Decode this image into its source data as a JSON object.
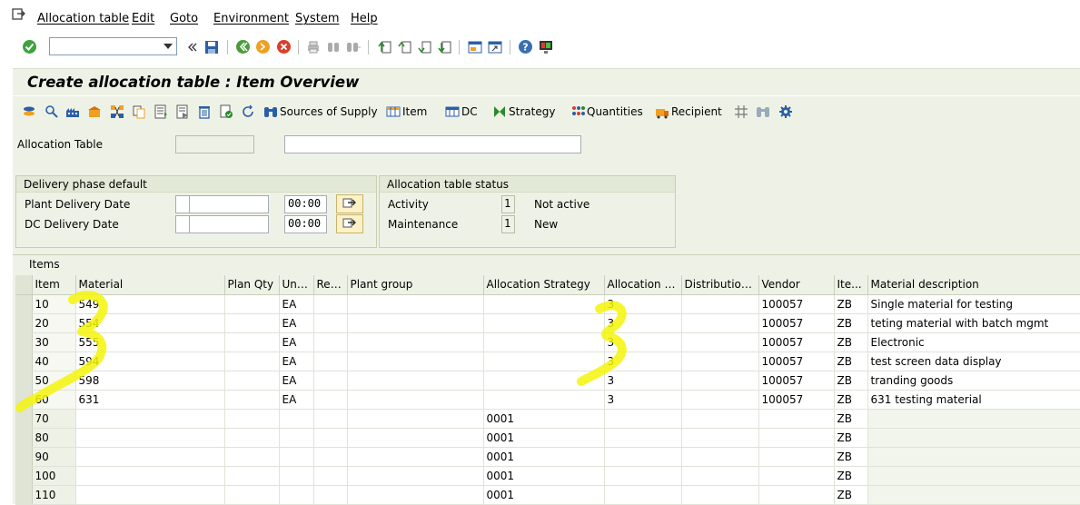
{
  "menu": {
    "items": [
      "Allocation table",
      "Edit",
      "Goto",
      "Environment",
      "System",
      "Help"
    ]
  },
  "command_field": {
    "value": ""
  },
  "title": "Create allocation table : Item Overview",
  "app_toolbar": {
    "sources_of_supply": "Sources of Supply",
    "item": "Item",
    "dc": "DC",
    "strategy": "Strategy",
    "quantities": "Quantities",
    "recipient": "Recipient"
  },
  "header": {
    "allocation_table_label": "Allocation Table",
    "allocation_table_value": "",
    "allocation_table_desc": ""
  },
  "delivery_phase": {
    "title": "Delivery phase default",
    "plant_label": "Plant Delivery Date",
    "plant_time": "00:00",
    "dc_label": "DC Delivery Date",
    "dc_time": "00:00"
  },
  "status": {
    "title": "Allocation table status",
    "activity_label": "Activity",
    "activity_value": "1",
    "activity_text": "Not active",
    "maintenance_label": "Maintenance",
    "maintenance_value": "1",
    "maintenance_text": "New"
  },
  "items": {
    "title": "Items",
    "columns": [
      "Item",
      "Material",
      "Plan Qty",
      "Uni...",
      "Rec...",
      "Plant group",
      "Allocation Strategy",
      "Allocation rule",
      "Distribution ...",
      "Vendor",
      "Ite...",
      "Material description"
    ],
    "rows": [
      [
        "10",
        "549",
        "",
        "EA",
        "",
        "",
        "",
        "3",
        "",
        "100057",
        "ZB",
        "Single material for testing"
      ],
      [
        "20",
        "554",
        "",
        "EA",
        "",
        "",
        "",
        "3",
        "",
        "100057",
        "ZB",
        "teting material with batch mgmt"
      ],
      [
        "30",
        "555",
        "",
        "EA",
        "",
        "",
        "",
        "3",
        "",
        "100057",
        "ZB",
        "Electronic"
      ],
      [
        "40",
        "594",
        "",
        "EA",
        "",
        "",
        "",
        "3",
        "",
        "100057",
        "ZB",
        "test screen data display"
      ],
      [
        "50",
        "598",
        "",
        "EA",
        "",
        "",
        "",
        "3",
        "",
        "100057",
        "ZB",
        "tranding goods"
      ],
      [
        "60",
        "631",
        "",
        "EA",
        "",
        "",
        "",
        "3",
        "",
        "100057",
        "ZB",
        "631 testing material"
      ],
      [
        "70",
        "",
        "",
        "",
        "",
        "",
        "0001",
        "",
        "",
        "",
        "ZB",
        ""
      ],
      [
        "80",
        "",
        "",
        "",
        "",
        "",
        "0001",
        "",
        "",
        "",
        "ZB",
        ""
      ],
      [
        "90",
        "",
        "",
        "",
        "",
        "",
        "0001",
        "",
        "",
        "",
        "ZB",
        ""
      ],
      [
        "100",
        "",
        "",
        "",
        "",
        "",
        "0001",
        "",
        "",
        "",
        "ZB",
        ""
      ],
      [
        "110",
        "",
        "",
        "",
        "",
        "",
        "0001",
        "",
        "",
        "",
        "ZB",
        ""
      ]
    ]
  },
  "colors": {
    "background": "#eef2e6",
    "highlight": "#f5f50a"
  }
}
